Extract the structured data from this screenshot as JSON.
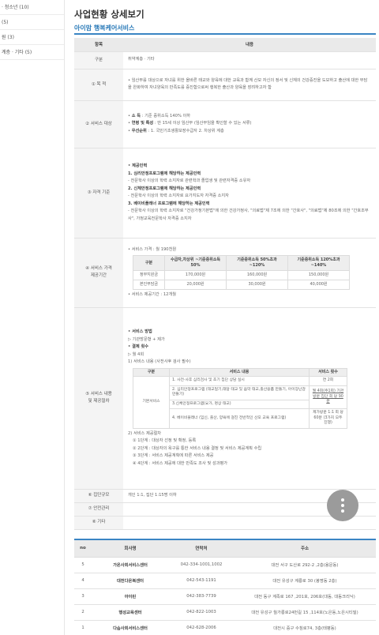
{
  "sidebar": {
    "items": [
      "· 청소년 (10)",
      "(5)",
      "원 (3)",
      "계층 · 기타 (5)"
    ]
  },
  "page": {
    "title": "사업현황 상세보기",
    "subtitle": "아이맘 행복케어서비스"
  },
  "detail": {
    "header": {
      "col1": "항목",
      "col2": "내용"
    },
    "category": {
      "label": "구분",
      "value": "취약계층 · 기타"
    },
    "purpose": {
      "label": "① 목 적",
      "text": "임산부를 대상으로 자녀를 위한 올바른 태교와 양육에 대한 교육과 함께 산모 자신의 정서 및 신체의 건강증진을 도모하고 출산에 대한 부담을 완화하여 자녀양육의 만족도를 증진함으로써 행복한 출산과 양육을 장려하고자 함"
    },
    "target": {
      "label": "② 서비스 대상",
      "lines": [
        {
          "key": "소 득",
          "text": " : 기준 중위소득 140% 이하"
        },
        {
          "key": "연령 및 특성",
          "text": " : 만 15세 이상 임산부 (임산부임을 확인할 수 있는 서류)"
        },
        {
          "key": "우선순위",
          "text": " : 1. 국민기초생활보장수급자 2. 차상위 계층"
        }
      ]
    },
    "qualification": {
      "label": "③ 자격 기준",
      "heading": "제공인력",
      "items": [
        {
          "title": "1. 심리안정프로그램에 해당하는 제공인력",
          "desc": "- 전문학사 이상의 학력 소지자로 관련학과 졸업생 및 관련자격증 소유자"
        },
        {
          "title": "2. 신체안정프로그램에 해당하는 제공인력",
          "desc": "- 전문학사 이상의 학력 소지자로 요가지도자 자격증 소지자"
        },
        {
          "title": "3. 베이비플래너 프로그램에 해당하는 제공인력",
          "desc": "- 전문학사 이상의 학력 소지자로 \"건강가정기본법\"에 의한 건강가정사, \"의료법\"제 7조에 의한 \"간호사\", \"의료법\"제 80조에 의한 \"간호조무사\", 가정교육전문학사 자격증 소지자"
        }
      ]
    },
    "price": {
      "label_1": "④ 서비스 가격",
      "label_2": "제공기간",
      "line1": "서비스 가격 : 월 190천원",
      "columns": [
        "구분",
        "수급자,차상위 ~기준중위소득50%",
        "기준중위소득 50%초과 ~120%",
        "기준중위소득 120%초과 ~140%"
      ],
      "rows": [
        {
          "name": "정부지원금",
          "values": [
            "170,000원",
            "160,000원",
            "150,000원"
          ]
        },
        {
          "name": "본인부담금",
          "values": [
            "20,000원",
            "30,000원",
            "40,000원"
          ]
        }
      ],
      "period": "서비스 제공기간 : 12개월"
    },
    "content": {
      "label_1": "⑤ 서비스 내용",
      "label_2": "및 제공절차",
      "method_heading": "서비스 방법",
      "method": "▷ 기관방문형 + 제가",
      "freq_heading": "결제 횟수",
      "freq": "▷ 월 4회",
      "sub_heading": "1) 서비스 내용 (사전사후 검사 필수)",
      "table": {
        "columns": [
          "구분",
          "서비스 내용",
          "서비스 횟수"
        ],
        "group": "기본서비스",
        "rows": [
          {
            "content": "1. 사전·사후 심리검사 및 초기 집단 상담 실시",
            "count": "연 2회"
          },
          {
            "content": "2. 심리안정프로그램 (태교일기,태담 태교 및 음악 태교,출산용품 만들기, 아이장난감 만들기)",
            "count": "월 4회(주1회) 기관방문 집단 회 당 90분"
          },
          {
            "content": "3.신체안정프로그램(요가, 명상 태교)",
            "count": ""
          },
          {
            "content": "4. 베이비플래너 (임신, 출산, 양육에 걸친 전반적인 산모 교육 프로그램)",
            "count": "제가방문 1:1 회 당 60분 (3가지 모두 진행)"
          }
        ]
      },
      "proc_heading": "2) 서비스 제공절차",
      "steps": [
        "① 1단계 : 대상자 선정 및 확정, 등록",
        "② 2단계 : 대상자의 욕구를 통한 서비스 내용 결정 및 서비스 제공계획 수립",
        "③ 3단계 : 서비스 제공계획에 따른 서비스 제공",
        "④ 4단계 : 서비스 제공에 대한 만족도 조사 및 성과평가"
      ]
    },
    "group_size": {
      "label": "⑥ 집단규모",
      "value": "개인 1:1, 집단 1:15명 이하"
    },
    "safety": {
      "label": "⑦ 안전관리",
      "value": ""
    },
    "other": {
      "label": "⑧ 기타",
      "value": ""
    }
  },
  "companies": {
    "columns": [
      "no",
      "회사명",
      "연락처",
      "주소"
    ],
    "rows": [
      {
        "no": "5",
        "name": "가온사회서비스센터",
        "phone": "042-334-1001,1002",
        "addr": "대전 서구 도산로 292-2 ,2층(용문동)"
      },
      {
        "no": "4",
        "name": "대전다온복센터",
        "phone": "042-543-1191",
        "addr": "대전 유성구 계룡로 30 (봉명동 2층)"
      },
      {
        "no": "3",
        "name": "아이린",
        "phone": "042-383-7739",
        "addr": "대전 동구 계족로 167 ,201호, 206호(대동, 대동크리닉)"
      },
      {
        "no": "2",
        "name": "행성교육센터",
        "phone": "042-822-1003",
        "addr": "대전 유성구 월가룡로24번길 15 ,114호(노은동,노은시티빌)"
      },
      {
        "no": "1",
        "name": "다솜사회서비스센터",
        "phone": "042-628-2006",
        "addr": "대전시 중구 수침로74, 3층(태평동)"
      }
    ]
  }
}
